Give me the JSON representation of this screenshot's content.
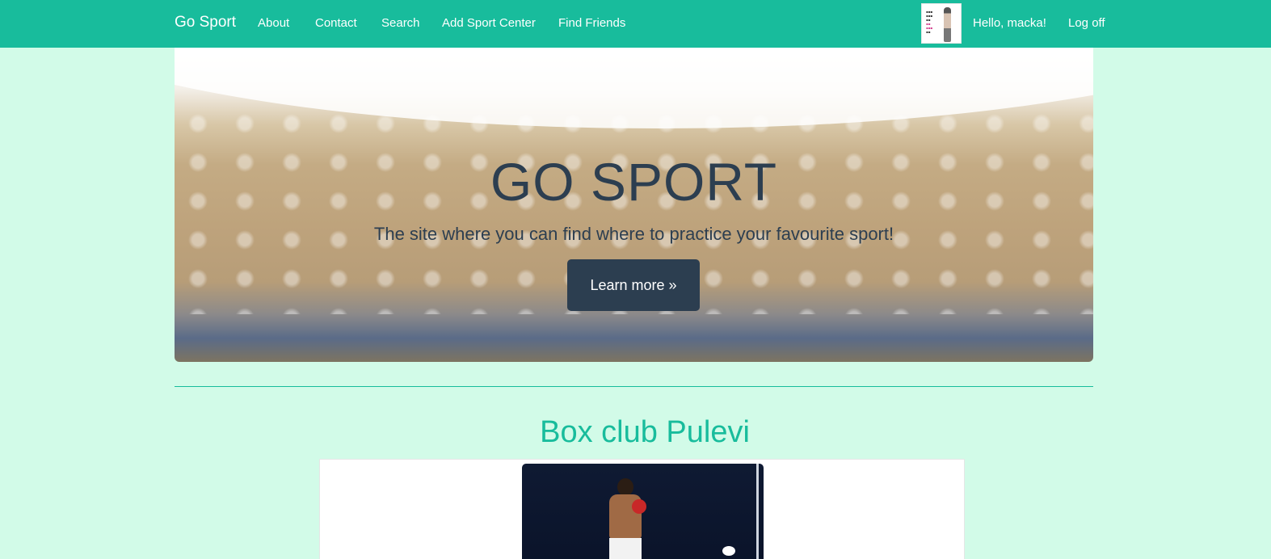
{
  "navbar": {
    "brand": "Go Sport",
    "links": [
      "About",
      "Contact",
      "Search",
      "Add Sport Center",
      "Find Friends"
    ],
    "greeting": "Hello, macka!",
    "logoff": "Log off",
    "colors": {
      "bar": "#18bc9c",
      "text": "#ffffff"
    }
  },
  "hero": {
    "title": "GO SPORT",
    "subtitle": "The site where you can find where to practice your favourite sport!",
    "button": "Learn more »"
  },
  "club": {
    "name": "Box club Pulevi"
  },
  "colors": {
    "page_background": "#d2fbe8",
    "accent": "#18bc9c",
    "dark": "#2c3e50"
  }
}
